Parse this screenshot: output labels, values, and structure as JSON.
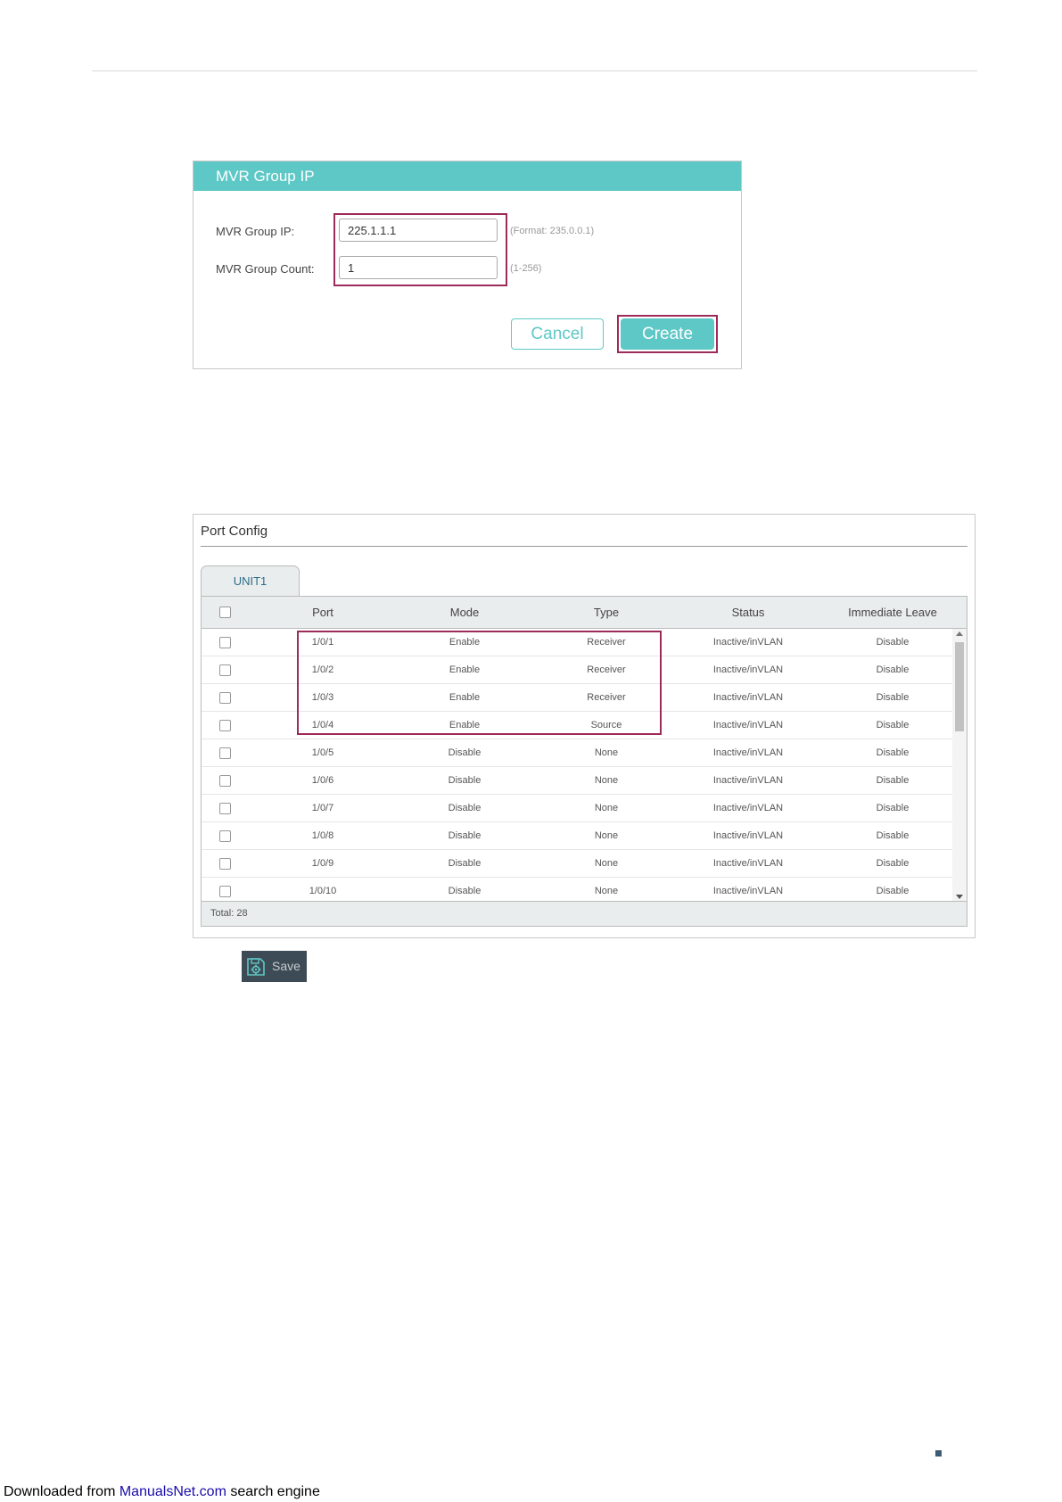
{
  "mvr_dialog": {
    "title": "MVR Group IP",
    "group_ip": {
      "label": "MVR Group IP:",
      "value": "225.1.1.1",
      "hint": "(Format: 235.0.0.1)"
    },
    "group_count": {
      "label": "MVR Group Count:",
      "value": "1",
      "hint": "(1-256)"
    },
    "cancel_label": "Cancel",
    "create_label": "Create",
    "accent_color": "#5ec8c6",
    "highlight_color": "#9c2a5a"
  },
  "port_config": {
    "title": "Port Config",
    "tab_label": "UNIT1",
    "columns": [
      "Port",
      "Mode",
      "Type",
      "Status",
      "Immediate Leave"
    ],
    "rows": [
      {
        "port": "1/0/1",
        "mode": "Enable",
        "type": "Receiver",
        "status": "Inactive/inVLAN",
        "leave": "Disable"
      },
      {
        "port": "1/0/2",
        "mode": "Enable",
        "type": "Receiver",
        "status": "Inactive/inVLAN",
        "leave": "Disable"
      },
      {
        "port": "1/0/3",
        "mode": "Enable",
        "type": "Receiver",
        "status": "Inactive/inVLAN",
        "leave": "Disable"
      },
      {
        "port": "1/0/4",
        "mode": "Enable",
        "type": "Source",
        "status": "Inactive/inVLAN",
        "leave": "Disable"
      },
      {
        "port": "1/0/5",
        "mode": "Disable",
        "type": "None",
        "status": "Inactive/inVLAN",
        "leave": "Disable"
      },
      {
        "port": "1/0/6",
        "mode": "Disable",
        "type": "None",
        "status": "Inactive/inVLAN",
        "leave": "Disable"
      },
      {
        "port": "1/0/7",
        "mode": "Disable",
        "type": "None",
        "status": "Inactive/inVLAN",
        "leave": "Disable"
      },
      {
        "port": "1/0/8",
        "mode": "Disable",
        "type": "None",
        "status": "Inactive/inVLAN",
        "leave": "Disable"
      },
      {
        "port": "1/0/9",
        "mode": "Disable",
        "type": "None",
        "status": "Inactive/inVLAN",
        "leave": "Disable"
      },
      {
        "port": "1/0/10",
        "mode": "Disable",
        "type": "None",
        "status": "Inactive/inVLAN",
        "leave": "Disable"
      }
    ],
    "total_label": "Total: 28"
  },
  "save_button": {
    "label": "Save",
    "icon": "save-gear-icon"
  },
  "footer": {
    "prefix": "Downloaded from ",
    "link": "ManualsNet.com",
    "suffix": " search engine"
  }
}
